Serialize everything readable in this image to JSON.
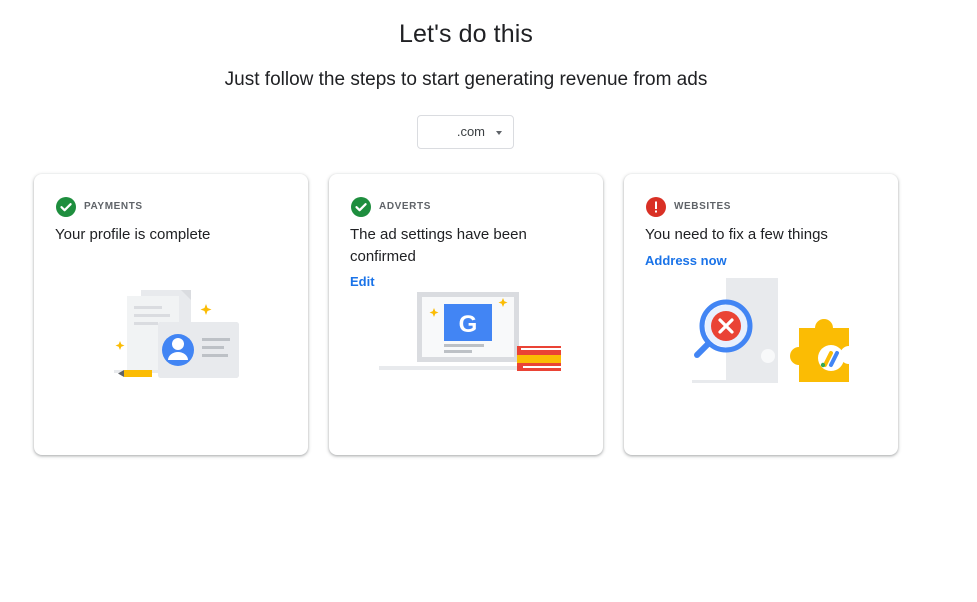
{
  "header": {
    "title": "Let's do this",
    "subtitle": "Just follow the steps to start generating revenue from ads"
  },
  "site_selector": {
    "value": ".com"
  },
  "cards": [
    {
      "eyebrow": "PAYMENTS",
      "title": "Your profile is complete",
      "status": "complete",
      "status_icon": "check-circle-icon",
      "status_color": "#1e8e3e"
    },
    {
      "eyebrow": "ADVERTS",
      "title": "The ad settings have been confirmed",
      "link": "Edit",
      "status": "complete",
      "status_icon": "check-circle-icon",
      "status_color": "#1e8e3e"
    },
    {
      "eyebrow": "WEBSITES",
      "title": "You need to fix a few things",
      "link": "Address now",
      "status": "error",
      "status_icon": "error-circle-icon",
      "status_color": "#d93025"
    }
  ],
  "colors": {
    "accent": "#1a73e8",
    "success": "#1e8e3e",
    "error": "#d93025",
    "google_yellow": "#fbbc04",
    "google_red": "#ea4335"
  }
}
